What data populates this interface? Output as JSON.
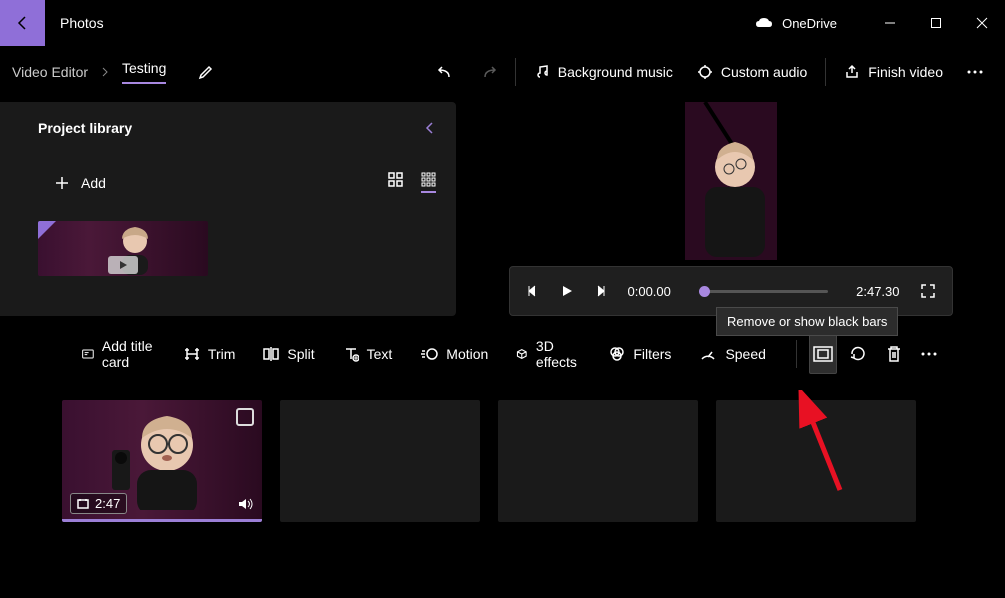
{
  "app_title": "Photos",
  "onedrive_label": "OneDrive",
  "breadcrumb": {
    "root": "Video Editor",
    "project": "Testing"
  },
  "toolbar": {
    "bg_music": "Background music",
    "custom_audio": "Custom audio",
    "finish": "Finish video"
  },
  "library": {
    "title": "Project library",
    "add_label": "Add"
  },
  "playback": {
    "current": "0:00.00",
    "total": "2:47.30"
  },
  "story_toolbar": {
    "title_card": "Add title card",
    "trim": "Trim",
    "split": "Split",
    "text": "Text",
    "motion": "Motion",
    "effects": "3D effects",
    "filters": "Filters",
    "speed": "Speed",
    "tooltip": "Remove or show black bars"
  },
  "clip": {
    "duration": "2:47"
  }
}
